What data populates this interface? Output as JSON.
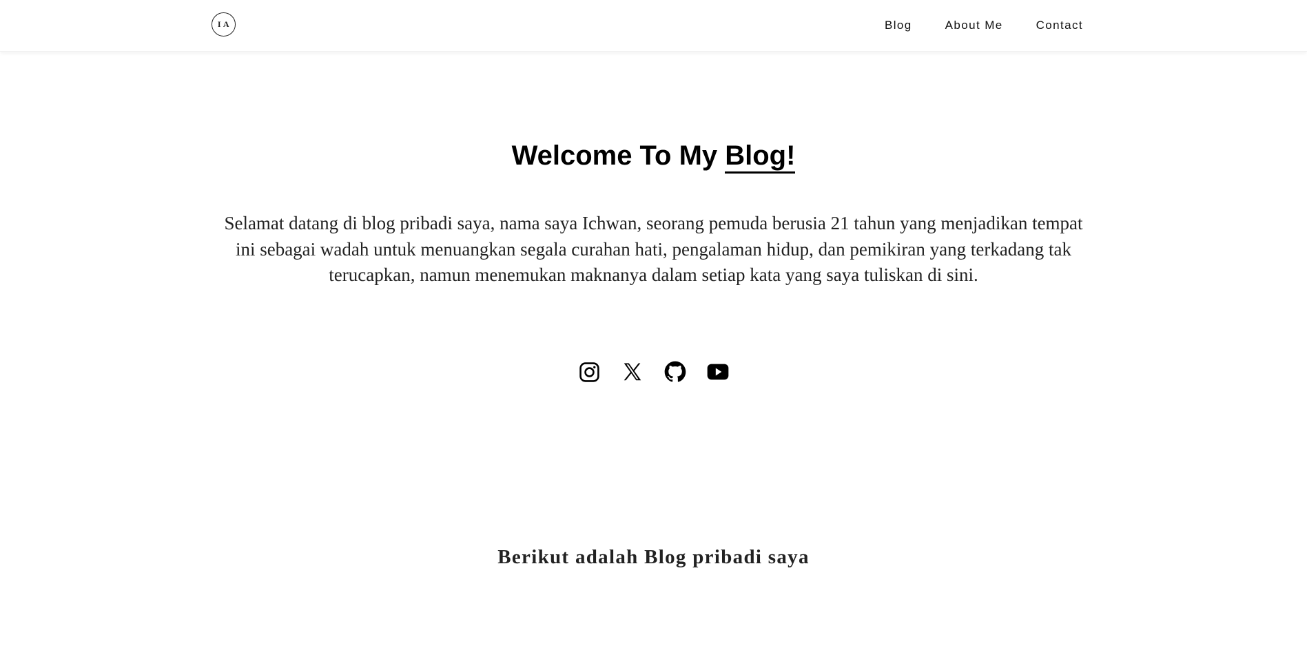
{
  "header": {
    "logo_text": "I A",
    "nav": [
      {
        "label": "Blog"
      },
      {
        "label": "About Me"
      },
      {
        "label": "Contact"
      }
    ]
  },
  "hero": {
    "title_prefix": "Welcome To My ",
    "title_highlight": "Blog!",
    "intro": "Selamat datang di blog pribadi saya, nama saya Ichwan, seorang pemuda berusia 21 tahun yang menjadikan tempat ini sebagai wadah untuk menuangkan segala curahan hati, pengalaman hidup, dan pemikiran yang terkadang tak terucapkan, namun menemukan maknanya dalam setiap kata yang saya tuliskan di sini."
  },
  "socials": [
    {
      "icon": "instagram-icon"
    },
    {
      "icon": "x-twitter-icon"
    },
    {
      "icon": "github-icon"
    },
    {
      "icon": "youtube-icon"
    }
  ],
  "blog_section": {
    "heading": "Berikut adalah Blog pribadi saya"
  }
}
